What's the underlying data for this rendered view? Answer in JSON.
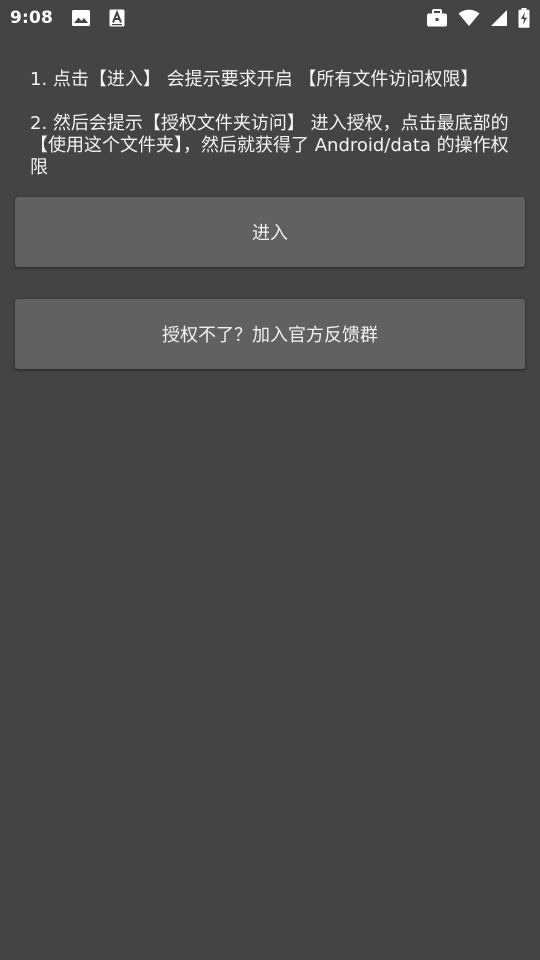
{
  "status_bar": {
    "time": "9:08",
    "left_icons": [
      "image-icon",
      "font-a-icon"
    ],
    "right_icons": [
      "briefcase-icon",
      "wifi-icon",
      "signal-icon",
      "battery-charging-icon"
    ]
  },
  "instructions": {
    "step1": "1. 点击【进入】 会提示要求开启 【所有文件访问权限】",
    "step2": "2. 然后会提示【授权文件夹访问】 进入授权，点击最底部的【使用这个文件夹】，然后就获得了 Android/data 的操作权限"
  },
  "buttons": {
    "enter_label": "进入",
    "feedback_label": "授权不了？加入官方反馈群"
  },
  "colors": {
    "background": "#444444",
    "button": "#616161",
    "text": "#ffffff"
  }
}
